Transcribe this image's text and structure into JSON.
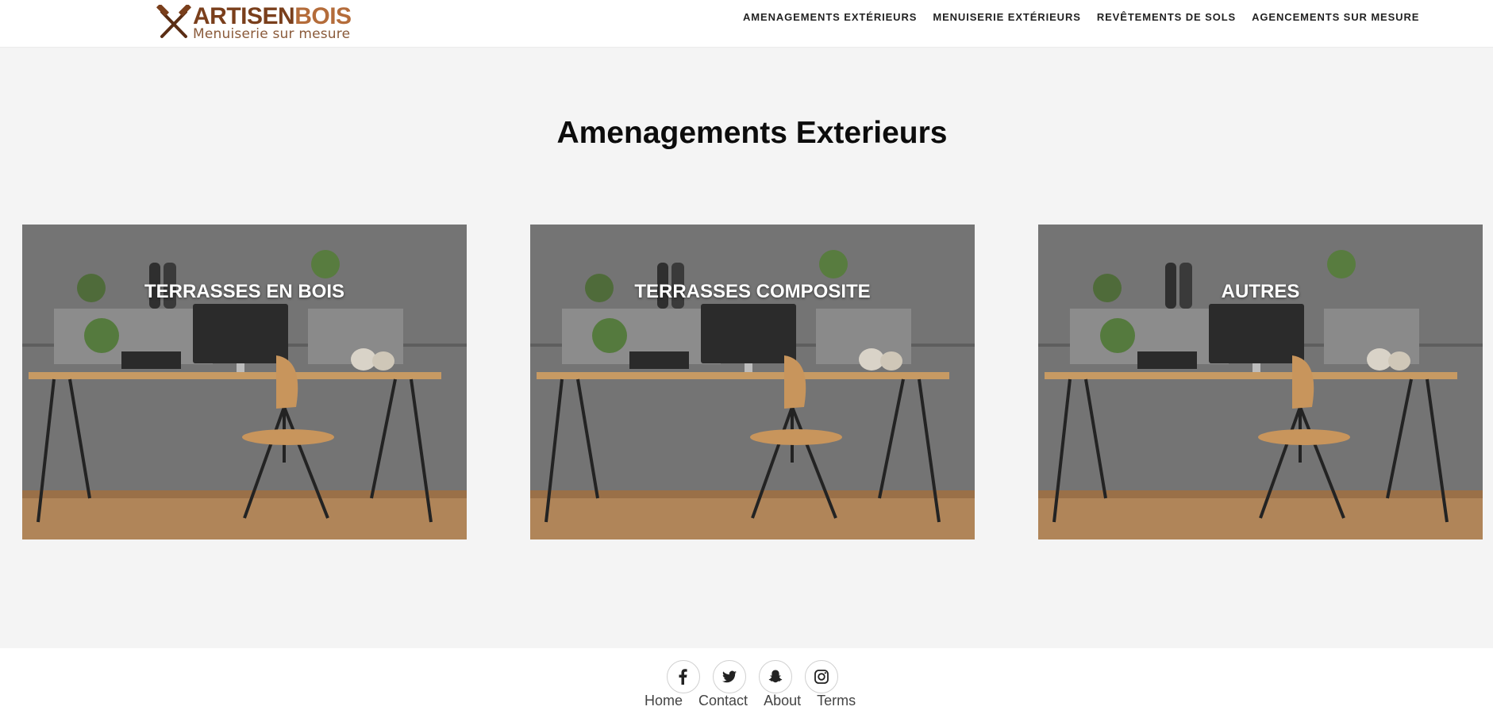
{
  "brand": {
    "name_part1": "ARTISEN",
    "name_part2": "BOIS",
    "tagline": "Menuiserie sur mesure",
    "colors": {
      "dark": "#7a3f1c",
      "light": "#b46c3a"
    },
    "icon": "crossed-hammers-icon"
  },
  "nav": {
    "items": [
      {
        "label": "AMENAGEMENTS EXTÉRIEURS"
      },
      {
        "label": "MENUISERIE EXTÉRIEURS"
      },
      {
        "label": "REVÊTEMENTS DE SOLS"
      },
      {
        "label": "AGENCEMENTS SUR MESURE"
      }
    ]
  },
  "main": {
    "title": "Amenagements Exterieurs",
    "cards": [
      {
        "label": "TERRASSES EN BOIS"
      },
      {
        "label": "TERRASSES COMPOSITE"
      },
      {
        "label": "AUTRES"
      }
    ]
  },
  "footer": {
    "social": [
      {
        "icon": "facebook-icon"
      },
      {
        "icon": "twitter-icon"
      },
      {
        "icon": "snapchat-icon"
      },
      {
        "icon": "instagram-icon"
      }
    ],
    "links": [
      {
        "label": "Home"
      },
      {
        "label": "Contact"
      },
      {
        "label": "About"
      },
      {
        "label": "Terms"
      }
    ]
  }
}
